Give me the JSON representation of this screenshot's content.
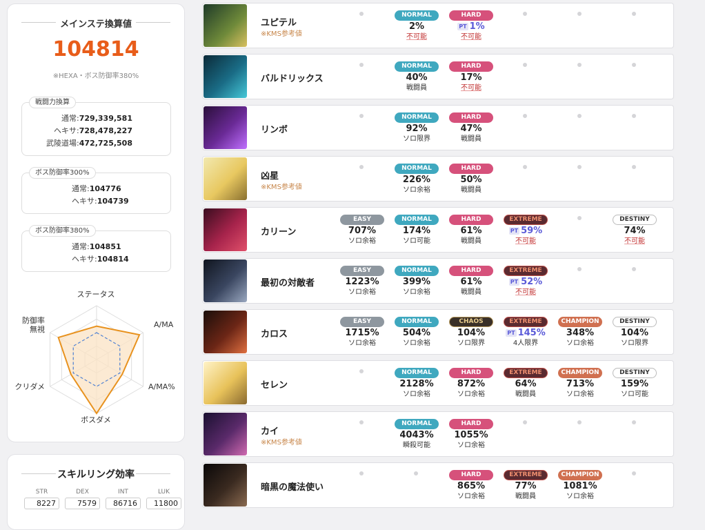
{
  "main_stat": {
    "title": "メインステ換算値",
    "value": "104814",
    "note": "※HEXA・ボス防御率380%"
  },
  "combat_power": {
    "title": "戦闘力換算",
    "rows": [
      {
        "k": "通常:",
        "v": "729,339,581"
      },
      {
        "k": "ヘキサ:",
        "v": "728,478,227"
      },
      {
        "k": "武陵道場:",
        "v": "472,725,508"
      }
    ]
  },
  "def300": {
    "title": "ボス防御率300%",
    "rows": [
      {
        "k": "通常:",
        "v": "104776"
      },
      {
        "k": "ヘキサ:",
        "v": "104739"
      }
    ]
  },
  "def380": {
    "title": "ボス防御率380%",
    "rows": [
      {
        "k": "通常:",
        "v": "104851"
      },
      {
        "k": "ヘキサ:",
        "v": "104814"
      }
    ]
  },
  "radar": {
    "labels": [
      "ステータス",
      "A/MA",
      "A/MA%",
      "ボスダメ",
      "クリダメ",
      "防御率\n無視"
    ],
    "values": [
      0.62,
      0.92,
      0.55,
      1.0,
      0.55,
      0.82
    ],
    "reference": [
      0.5,
      0.5,
      0.5,
      0.5,
      0.5,
      0.5
    ],
    "colors": {
      "fill": "#fbe3c4",
      "stroke": "#e8921e",
      "ref": "#4a7fd4"
    }
  },
  "skill_ring": {
    "title": "スキルリング効率",
    "stats": [
      {
        "label": "STR",
        "value": "8227"
      },
      {
        "label": "DEX",
        "value": "7579"
      },
      {
        "label": "INT",
        "value": "86716"
      },
      {
        "label": "LUK",
        "value": "11800"
      }
    ]
  },
  "bosses": [
    {
      "name": "ユピテル",
      "kms": "※KMS参考値",
      "theme": "jupiter",
      "cells": [
        null,
        {
          "d": "NORMAL",
          "p": "2%",
          "s": "不可能",
          "bad": true
        },
        {
          "d": "HARD",
          "p": "1%",
          "pt": true,
          "s": "不可能",
          "bad": true
        },
        null,
        null,
        null
      ]
    },
    {
      "name": "バルドリックス",
      "theme": "baldrix",
      "cells": [
        null,
        {
          "d": "NORMAL",
          "p": "40%",
          "s": "戦闘員"
        },
        {
          "d": "HARD",
          "p": "17%",
          "s": "不可能",
          "bad": true
        },
        null,
        null,
        null
      ]
    },
    {
      "name": "リンボ",
      "theme": "limbo",
      "cells": [
        null,
        {
          "d": "NORMAL",
          "p": "92%",
          "s": "ソロ限界"
        },
        {
          "d": "HARD",
          "p": "47%",
          "s": "戦闘員"
        },
        null,
        null,
        null
      ]
    },
    {
      "name": "凶星",
      "kms": "※KMS参考値",
      "theme": "star",
      "cells": [
        null,
        {
          "d": "NORMAL",
          "p": "226%",
          "s": "ソロ余裕"
        },
        {
          "d": "HARD",
          "p": "50%",
          "s": "戦闘員"
        },
        null,
        null,
        null
      ]
    },
    {
      "name": "カリーン",
      "theme": "kalos2",
      "cells": [
        {
          "d": "EASY",
          "p": "707%",
          "s": "ソロ余裕"
        },
        {
          "d": "NORMAL",
          "p": "174%",
          "s": "ソロ可能"
        },
        {
          "d": "HARD",
          "p": "61%",
          "s": "戦闘員"
        },
        {
          "d": "EXTREME",
          "p": "59%",
          "pt": true,
          "s": "不可能",
          "bad": true
        },
        null,
        {
          "d": "DESTINY",
          "p": "74%",
          "s": "不可能",
          "bad": true
        }
      ]
    },
    {
      "name": "最初の対敵者",
      "theme": "adversary",
      "cells": [
        {
          "d": "EASY",
          "p": "1223%",
          "s": "ソロ余裕"
        },
        {
          "d": "NORMAL",
          "p": "399%",
          "s": "ソロ余裕"
        },
        {
          "d": "HARD",
          "p": "61%",
          "s": "戦闘員"
        },
        {
          "d": "EXTREME",
          "p": "52%",
          "pt": true,
          "s": "不可能",
          "bad": true
        },
        null,
        null
      ]
    },
    {
      "name": "カロス",
      "theme": "kalos",
      "cells": [
        {
          "d": "EASY",
          "p": "1715%",
          "s": "ソロ余裕"
        },
        {
          "d": "NORMAL",
          "p": "504%",
          "s": "ソロ余裕"
        },
        {
          "d": "CHAOS",
          "p": "104%",
          "s": "ソロ限界"
        },
        {
          "d": "EXTREME",
          "p": "145%",
          "pt": true,
          "s": "4人限界"
        },
        {
          "d": "CHAMPION",
          "p": "348%",
          "s": "ソロ余裕"
        },
        {
          "d": "DESTINY",
          "p": "104%",
          "s": "ソロ限界"
        }
      ]
    },
    {
      "name": "セレン",
      "theme": "seren",
      "cells": [
        null,
        {
          "d": "NORMAL",
          "p": "2128%",
          "s": "ソロ余裕"
        },
        {
          "d": "HARD",
          "p": "872%",
          "s": "ソロ余裕"
        },
        {
          "d": "EXTREME",
          "p": "64%",
          "s": "戦闘員"
        },
        {
          "d": "CHAMPION",
          "p": "713%",
          "s": "ソロ余裕"
        },
        {
          "d": "DESTINY",
          "p": "159%",
          "s": "ソロ可能"
        }
      ]
    },
    {
      "name": "カイ",
      "kms": "※KMS参考値",
      "theme": "kai",
      "cells": [
        null,
        {
          "d": "NORMAL",
          "p": "4043%",
          "s": "瞬殺可能"
        },
        {
          "d": "HARD",
          "p": "1055%",
          "s": "ソロ余裕"
        },
        null,
        null,
        null
      ]
    },
    {
      "name": "暗黒の魔法使い",
      "theme": "blackmage",
      "cells": [
        null,
        null,
        {
          "d": "HARD",
          "p": "865%",
          "s": "ソロ余裕"
        },
        {
          "d": "EXTREME",
          "p": "77%",
          "s": "戦闘員"
        },
        {
          "d": "CHAMPION",
          "p": "1081%",
          "s": "ソロ余裕"
        },
        null
      ]
    }
  ]
}
